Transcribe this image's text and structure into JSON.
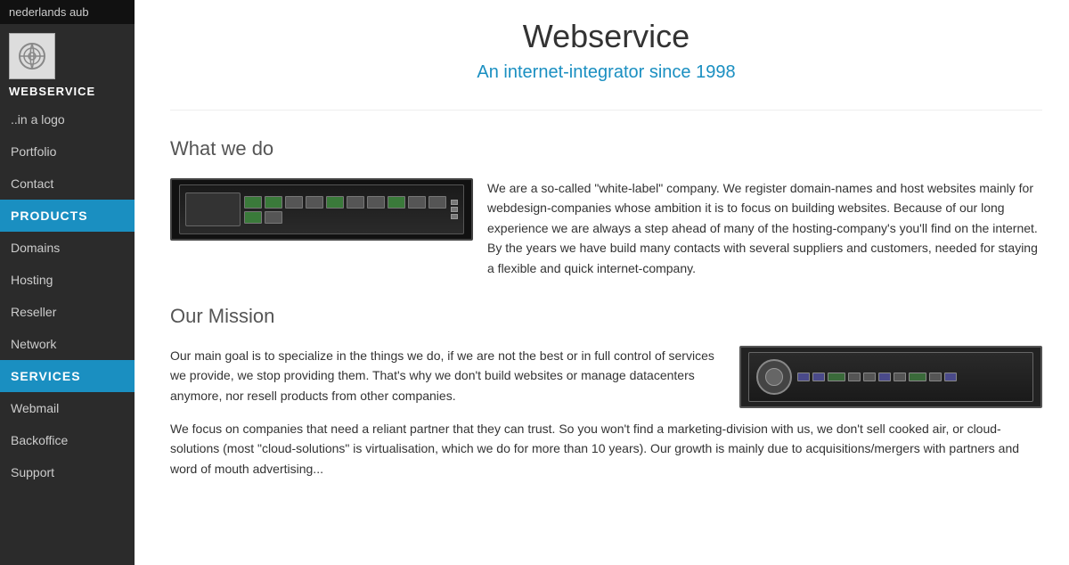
{
  "sidebar": {
    "top_bar": "nederlands aub",
    "site_name": "WEBSERVICE",
    "nav_items": [
      {
        "label": "..in a logo",
        "id": "in-a-logo"
      },
      {
        "label": "Portfolio",
        "id": "portfolio"
      },
      {
        "label": "Contact",
        "id": "contact"
      }
    ],
    "products_section": "PRODUCTS",
    "products_items": [
      {
        "label": "Domains",
        "id": "domains"
      },
      {
        "label": "Hosting",
        "id": "hosting"
      },
      {
        "label": "Reseller",
        "id": "reseller"
      },
      {
        "label": "Network",
        "id": "network"
      }
    ],
    "services_section": "SERVICES",
    "services_items": [
      {
        "label": "Webmail",
        "id": "webmail"
      },
      {
        "label": "Backoffice",
        "id": "backoffice"
      },
      {
        "label": "Support",
        "id": "support"
      }
    ]
  },
  "main": {
    "page_title": "Webservice",
    "page_subtitle": "An internet-integrator since 1998",
    "what_we_do_heading": "What we do",
    "what_we_do_text": "We are a so-called \"white-label\" company. We register domain-names and host websites mainly for webdesign-companies whose ambition it is to focus on building websites. Because of our long experience we are always a step ahead of many of the hosting-company's you'll find on the internet. By the years we have build many contacts with several suppliers and customers, needed for staying a flexible and quick internet-company.",
    "our_mission_heading": "Our Mission",
    "our_mission_text1": "Our main goal is to specialize in the things we do, if we are not the best or in full control of services we provide, we stop providing them. That's why we don't build websites or manage datacenters anymore, nor resell products from other companies.",
    "our_mission_text2": "We focus on companies that need a reliant partner that they can trust. So you won't find a marketing-division with us, we don't sell cooked air, or cloud-solutions (most \"cloud-solutions\" is virtualisation, which we do for more than 10 years). Our growth is mainly due to acquisitions/mergers with partners and word of mouth advertising..."
  }
}
